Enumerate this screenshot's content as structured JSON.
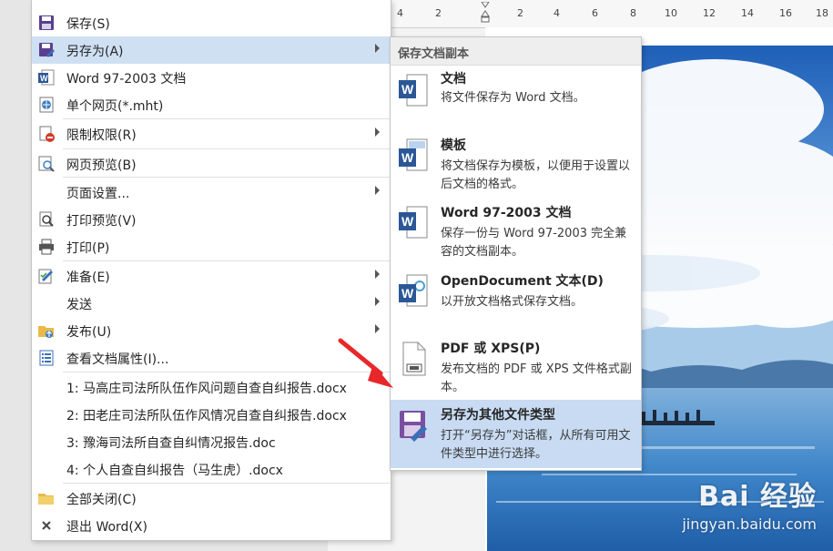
{
  "ruler": {
    "ticks": [
      "4",
      "2",
      "2",
      "4",
      "6",
      "8",
      "10",
      "12",
      "14",
      "16",
      "18"
    ]
  },
  "file_menu": {
    "items": [
      {
        "label": "保存(S)",
        "icon": "save-icon",
        "arrow": false
      },
      {
        "label": "另存为(A)",
        "icon": "save-as-icon",
        "arrow": true
      },
      {
        "label": "Word 97-2003 文档",
        "icon": "word-doc-icon",
        "arrow": false
      },
      {
        "label": "单个网页(*.mht)",
        "icon": "web-page-icon",
        "arrow": false
      },
      {
        "label": "限制权限(R)",
        "icon": "restrict-icon",
        "arrow": true
      },
      {
        "label": "网页预览(B)",
        "icon": "web-preview-icon",
        "arrow": false
      },
      {
        "label": "页面设置...",
        "icon": "",
        "arrow": true
      },
      {
        "label": "打印预览(V)",
        "icon": "print-preview-icon",
        "arrow": false
      },
      {
        "label": "打印(P)",
        "icon": "print-icon",
        "arrow": false
      },
      {
        "label": "准备(E)",
        "icon": "prepare-icon",
        "arrow": true
      },
      {
        "label": "发送",
        "icon": "",
        "arrow": true
      },
      {
        "label": "发布(U)",
        "icon": "publish-icon",
        "arrow": true
      },
      {
        "label": "查看文档属性(I)...",
        "icon": "properties-icon",
        "arrow": false
      }
    ],
    "recent_files": [
      "1: 马高庄司法所队伍作风问题自查自纠报告.docx",
      "2: 田老庄司法所队伍作风情况自查自纠报告.docx",
      "3: 豫海司法所自查自纠情况报告.doc",
      "4: 个人自查自纠报告（马生虎）.docx"
    ],
    "close_all": "全部关闭(C)",
    "exit": "退出 Word(X)"
  },
  "save_as_submenu": {
    "header": "保存文档副本",
    "options": [
      {
        "title": "文档",
        "desc": "将文件保存为 Word 文档。",
        "icon": "word-document-icon"
      },
      {
        "title": "模板",
        "desc": "将文档保存为模板，以便用于设置以后文档的格式。",
        "icon": "template-icon"
      },
      {
        "title": "Word 97-2003 文档",
        "desc": "保存一份与 Word 97-2003 完全兼容的文档副本。",
        "icon": "word-97-2003-icon"
      },
      {
        "title": "OpenDocument 文本(D)",
        "desc": "以开放文档格式保存文档。",
        "icon": "opendocument-icon"
      },
      {
        "title": "PDF 或 XPS(P)",
        "desc": "发布文档的 PDF 或 XPS 文件格式副本。",
        "icon": "pdf-xps-icon"
      },
      {
        "title": "另存为其他文件类型",
        "desc": "打开“另存为”对话框，从所有可用文件类型中进行选择。",
        "icon": "save-other-formats-icon"
      }
    ]
  },
  "watermark": {
    "main": "Bai  经验",
    "sub": "jingyan.baidu.com"
  }
}
